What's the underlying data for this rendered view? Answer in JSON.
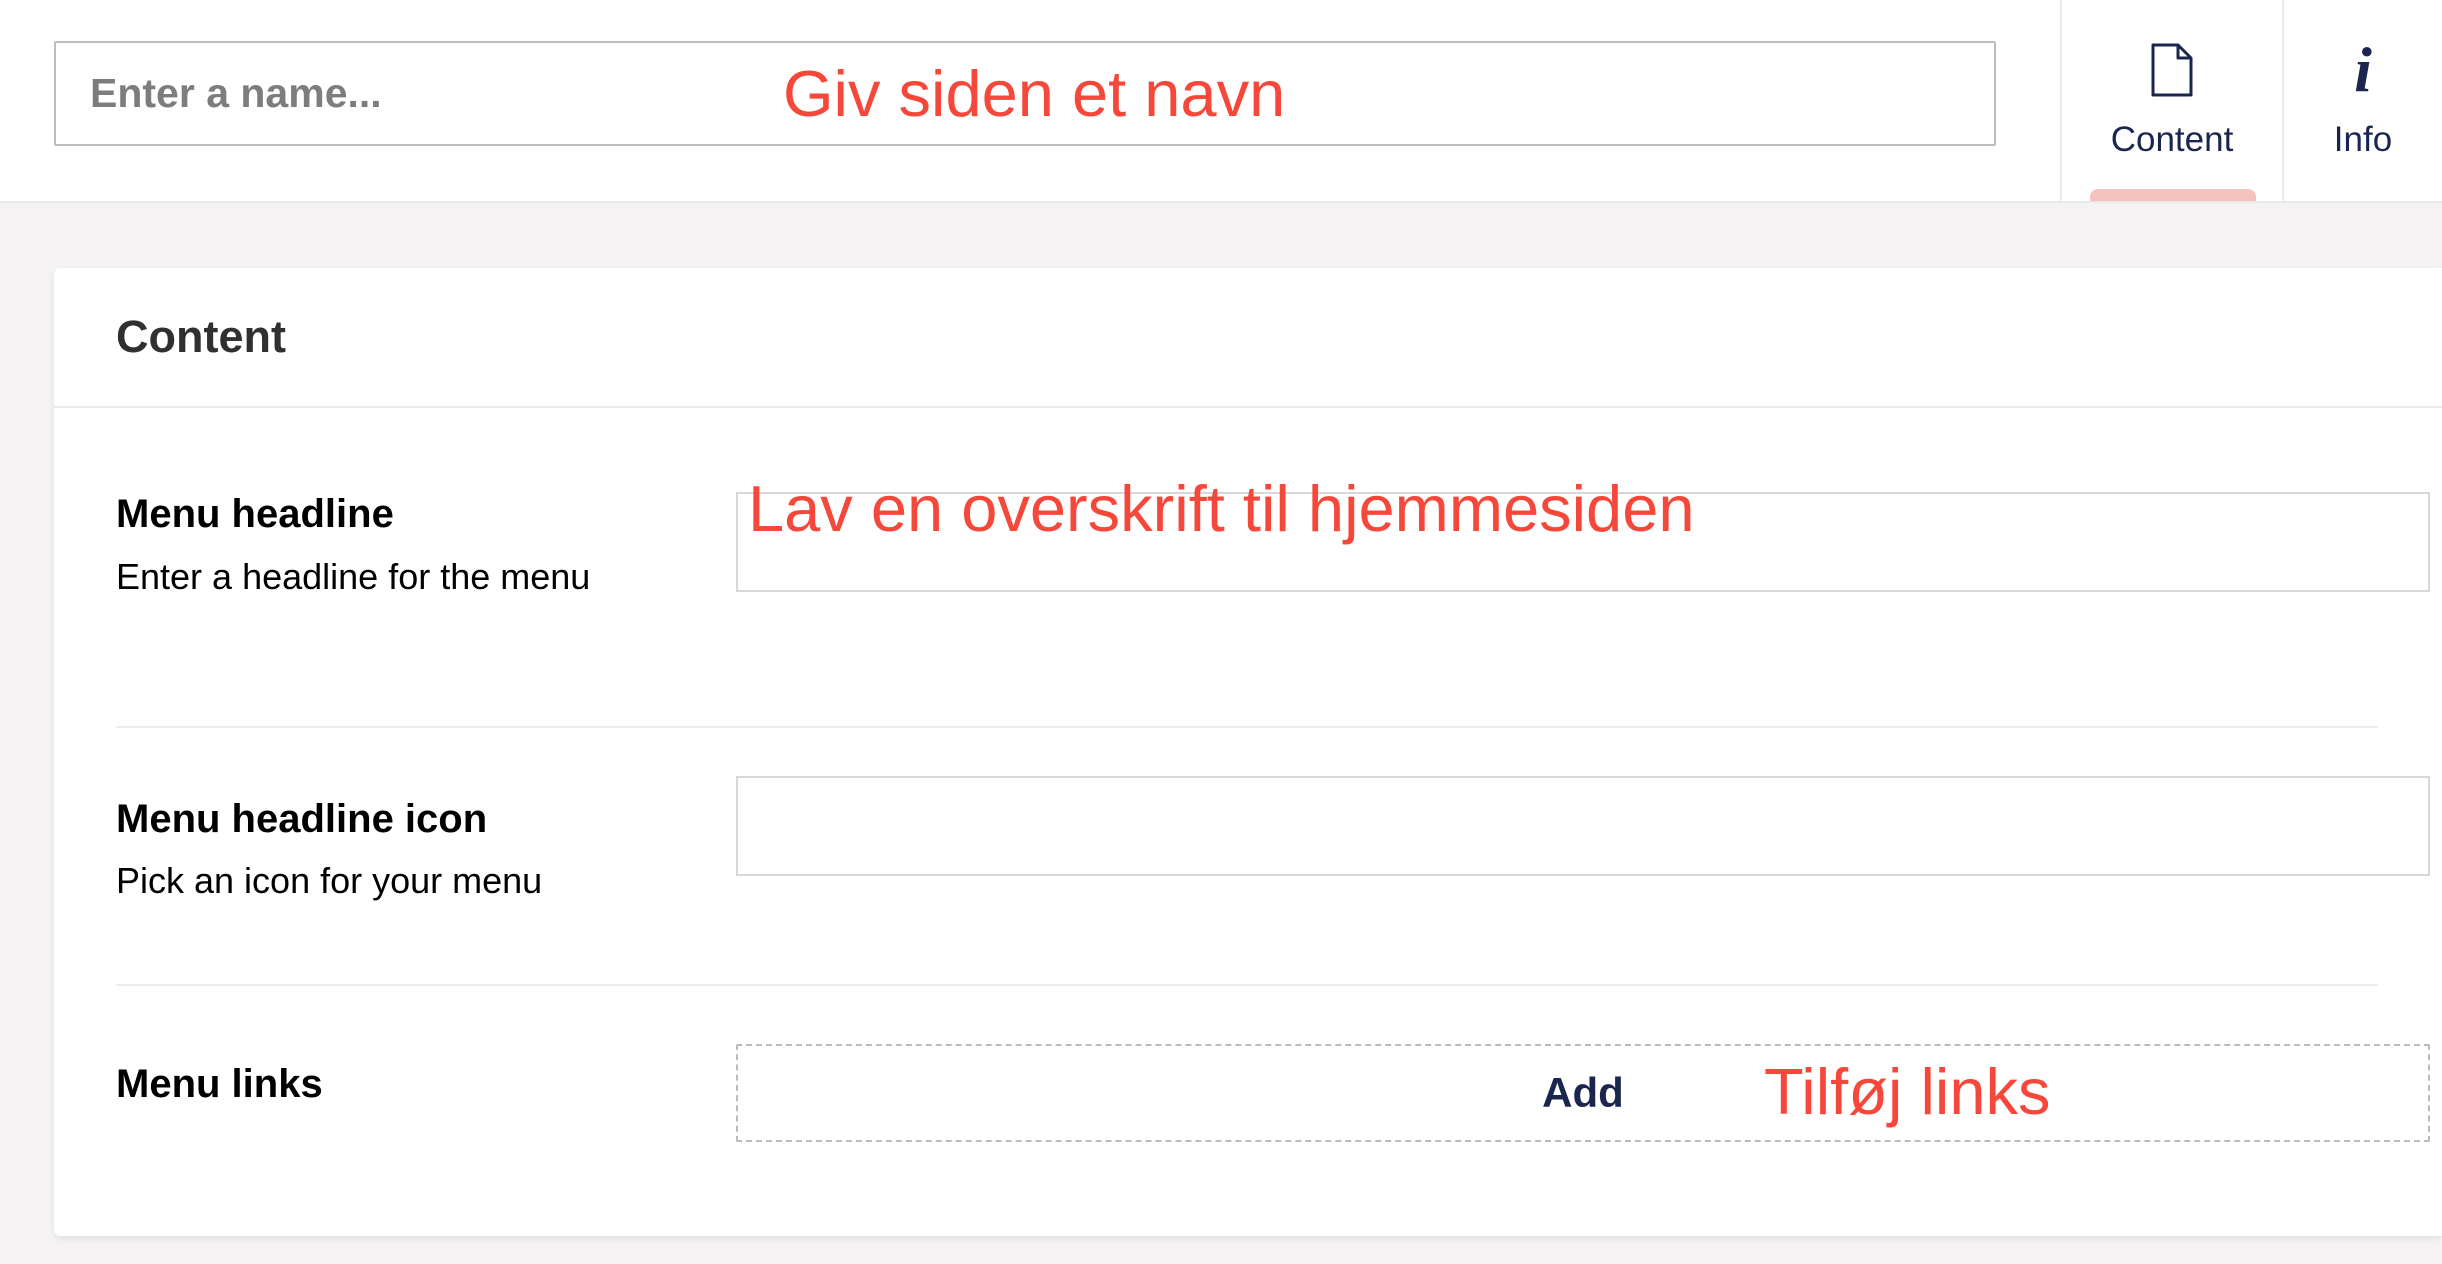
{
  "header": {
    "name_placeholder": "Enter a name...",
    "tabs": [
      {
        "label": "Content",
        "icon": "document-icon",
        "active": true
      },
      {
        "label": "Info",
        "icon": "info-icon",
        "active": false
      }
    ]
  },
  "annotations": {
    "name": "Giv siden et navn",
    "headline": "Lav en overskrift til hjemmesiden",
    "links": "Tilføj links"
  },
  "panel": {
    "title": "Content",
    "properties": [
      {
        "label": "Menu headline",
        "description": "Enter a headline for the menu",
        "value": ""
      },
      {
        "label": "Menu headline icon",
        "description": "Pick an icon for your menu",
        "value": ""
      },
      {
        "label": "Menu links",
        "add_label": "Add"
      }
    ]
  },
  "colors": {
    "background": "#f4f2f2",
    "accent_navy": "#1b264f",
    "annotation_red": "#f5483a",
    "active_tab_indicator": "#f5c1bc"
  }
}
